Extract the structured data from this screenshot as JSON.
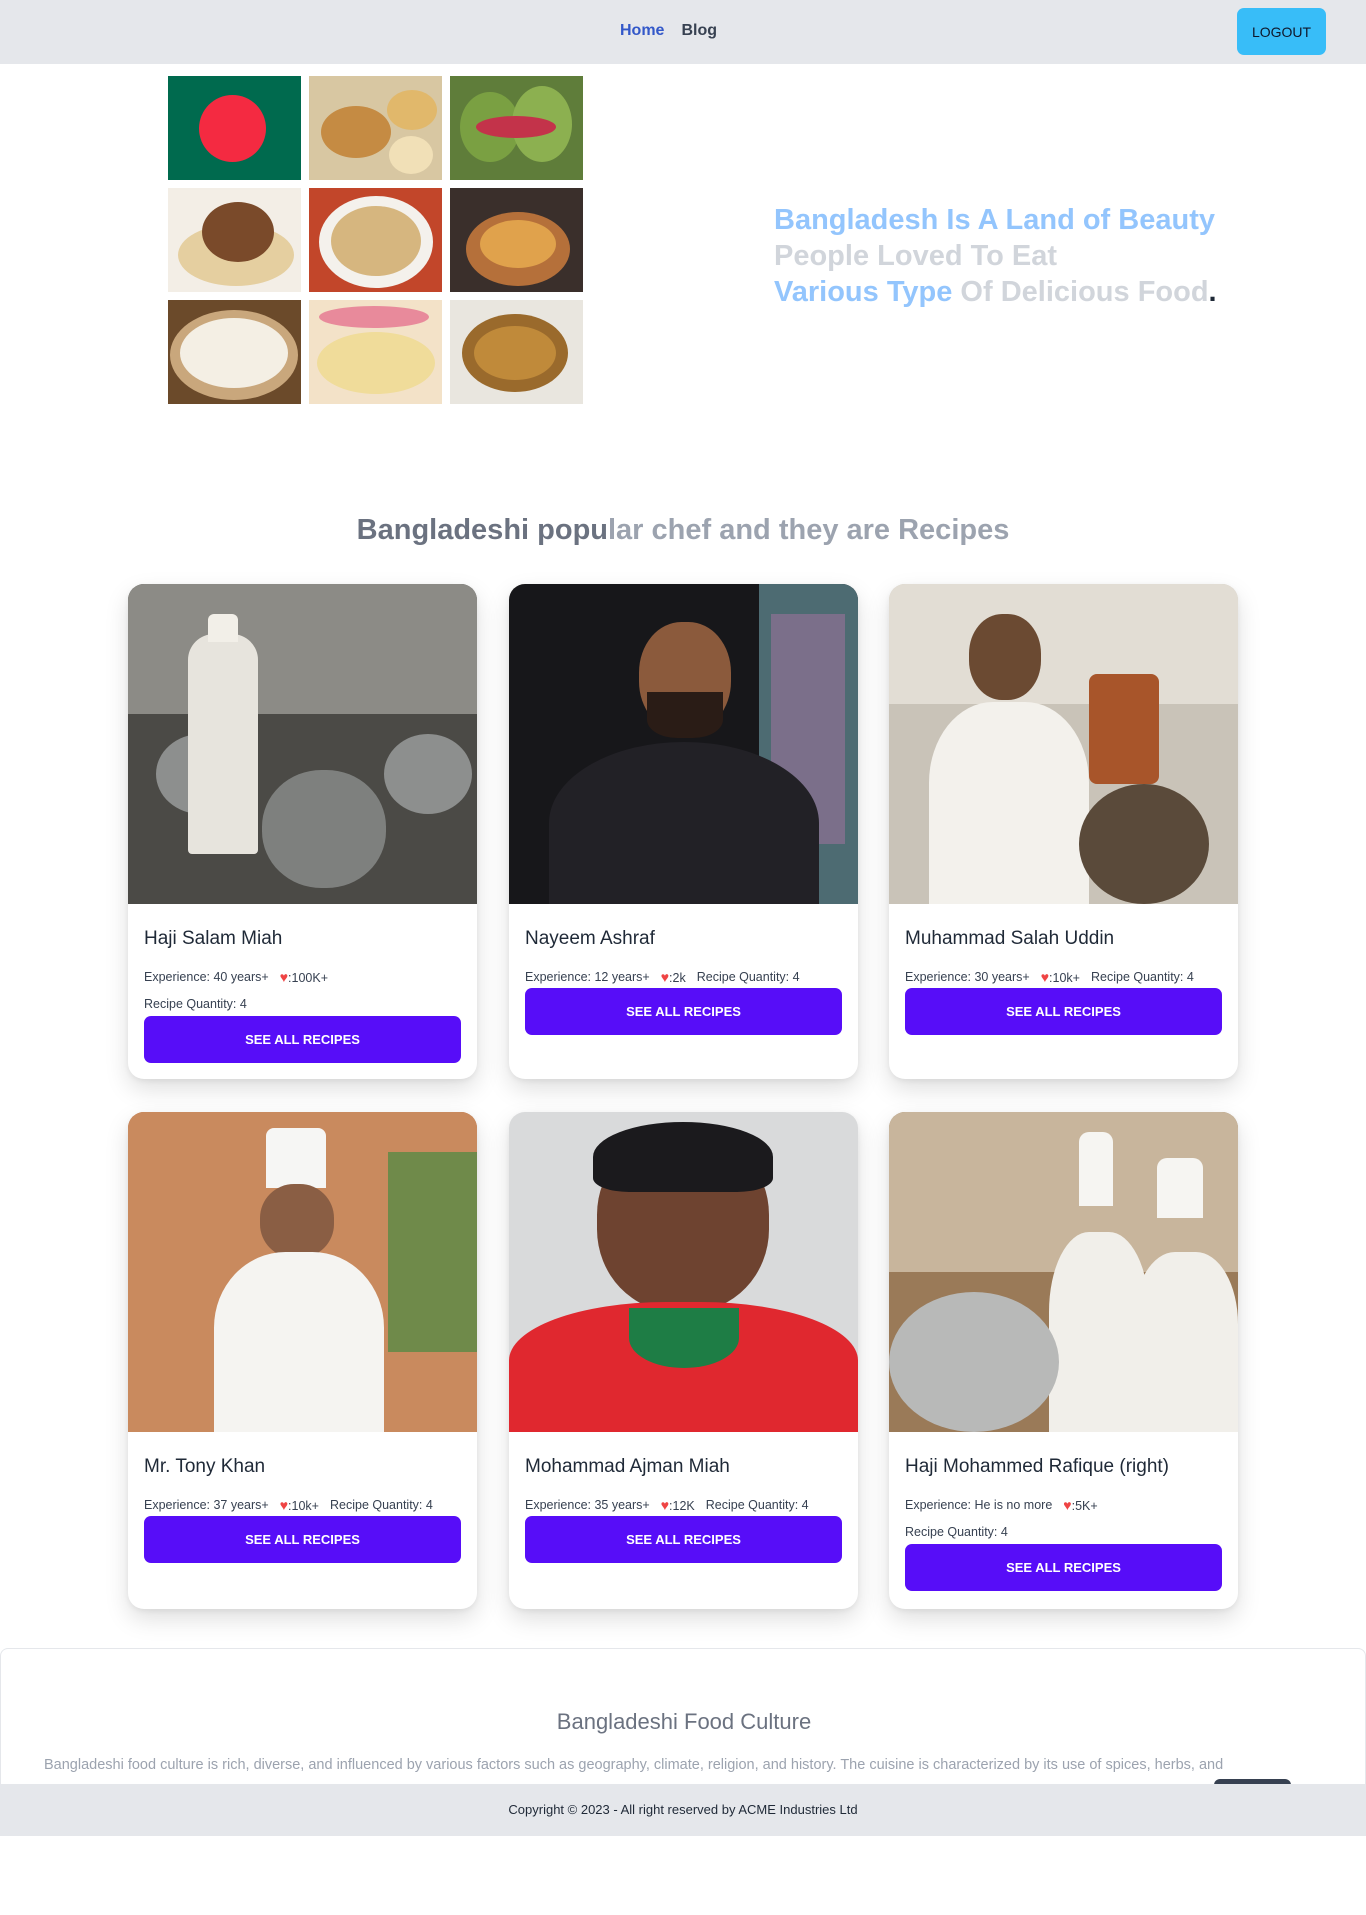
{
  "nav": {
    "links": [
      "Home",
      "Blog"
    ],
    "logout_label": "LOGOUT"
  },
  "hero": {
    "line1": "Bangladesh Is A Land of Beauty",
    "line2": "People Loved To Eat",
    "line3_a": "Various Type",
    "line3_b": " Of Delicious Food",
    "line3_c": ".",
    "colors": {
      "blue": "#93c5fd",
      "gray": "#d1d5db"
    },
    "tiles": [
      "flag",
      "samosa-platter",
      "paan",
      "biryani",
      "haleem",
      "fuchka",
      "rasgulla",
      "ras-malai",
      "curry"
    ]
  },
  "section": {
    "title_a": "Bangladeshi popu",
    "title_b": "lar chef and they are Recipes"
  },
  "chefs": [
    {
      "name": "Haji Salam Miah",
      "experience": "Experience: 40 years+",
      "likes": ":100K+",
      "recipes": "Recipe Quantity: 4",
      "button": "SEE ALL RECIPES"
    },
    {
      "name": "Nayeem Ashraf",
      "experience": "Experience: 12 years+",
      "likes": ":2k",
      "recipes": "Recipe Quantity: 4",
      "button": "SEE ALL RECIPES"
    },
    {
      "name": "Muhammad Salah Uddin",
      "experience": "Experience: 30 years+",
      "likes": ":10k+",
      "recipes": "Recipe Quantity: 4",
      "button": "SEE ALL RECIPES"
    },
    {
      "name": "Mr. Tony Khan",
      "experience": "Experience: 37 years+",
      "likes": ":10k+",
      "recipes": "Recipe Quantity: 4",
      "button": "SEE ALL RECIPES"
    },
    {
      "name": "Mohammad Ajman Miah",
      "experience": "Experience: 35 years+",
      "likes": ":12K",
      "recipes": "Recipe Quantity: 4",
      "button": "SEE ALL RECIPES"
    },
    {
      "name": "Haji Mohammed Rafique (right)",
      "experience": "Experience: He is no more",
      "likes": ":5K+",
      "recipes": "Recipe Quantity: 4",
      "button": "SEE ALL RECIPES"
    }
  ],
  "culture": {
    "title": "Bangladeshi Food Culture",
    "text": "Bangladeshi food culture is rich, diverse, and influenced by various factors such as geography, climate, religion, and history. The cuisine is characterized by its use of spices, herbs, and"
  },
  "footer": {
    "copyright": "Copyright © 2023 - All right reserved by ACME Industries Ltd"
  },
  "theme": {
    "accent": "#570df8",
    "logout": "#38bdf8",
    "nav_active": "#3358c9",
    "heart": "#ef4444"
  }
}
